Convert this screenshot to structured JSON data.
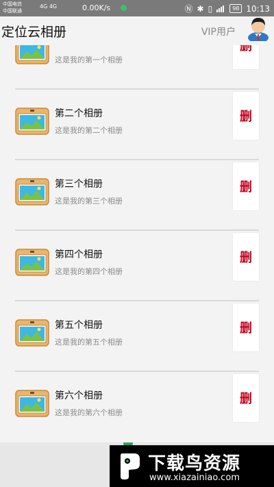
{
  "status_bar": {
    "carrier_1": "中国电信",
    "carrier_2": "中国联通",
    "network_label": "4G 4G",
    "speed": "0.00K/s",
    "battery": "98",
    "time": "10:13"
  },
  "header": {
    "title": "定位云相册",
    "vip_label": "VIP用户"
  },
  "albums": [
    {
      "name": "",
      "desc": "这是我的第一个相册",
      "delete_label": "删"
    },
    {
      "name": "第二个相册",
      "desc": "这是我的第二个相册",
      "delete_label": "删"
    },
    {
      "name": "第三个相册",
      "desc": "这是我的第三个相册",
      "delete_label": "删"
    },
    {
      "name": "第四个相册",
      "desc": "这是我的第四个相册",
      "delete_label": "删"
    },
    {
      "name": "第五个相册",
      "desc": "这是我的第五个相册",
      "delete_label": "删"
    },
    {
      "name": "第六个相册",
      "desc": "这是我的第六个相册",
      "delete_label": "删"
    }
  ],
  "watermark": {
    "title": "下载鸟资源",
    "url": "www.xiazainiao.com"
  },
  "colors": {
    "delete_text": "#c3001d",
    "status_bar_bg": "#7a7a7a",
    "page_bg": "#f3f3f3"
  }
}
